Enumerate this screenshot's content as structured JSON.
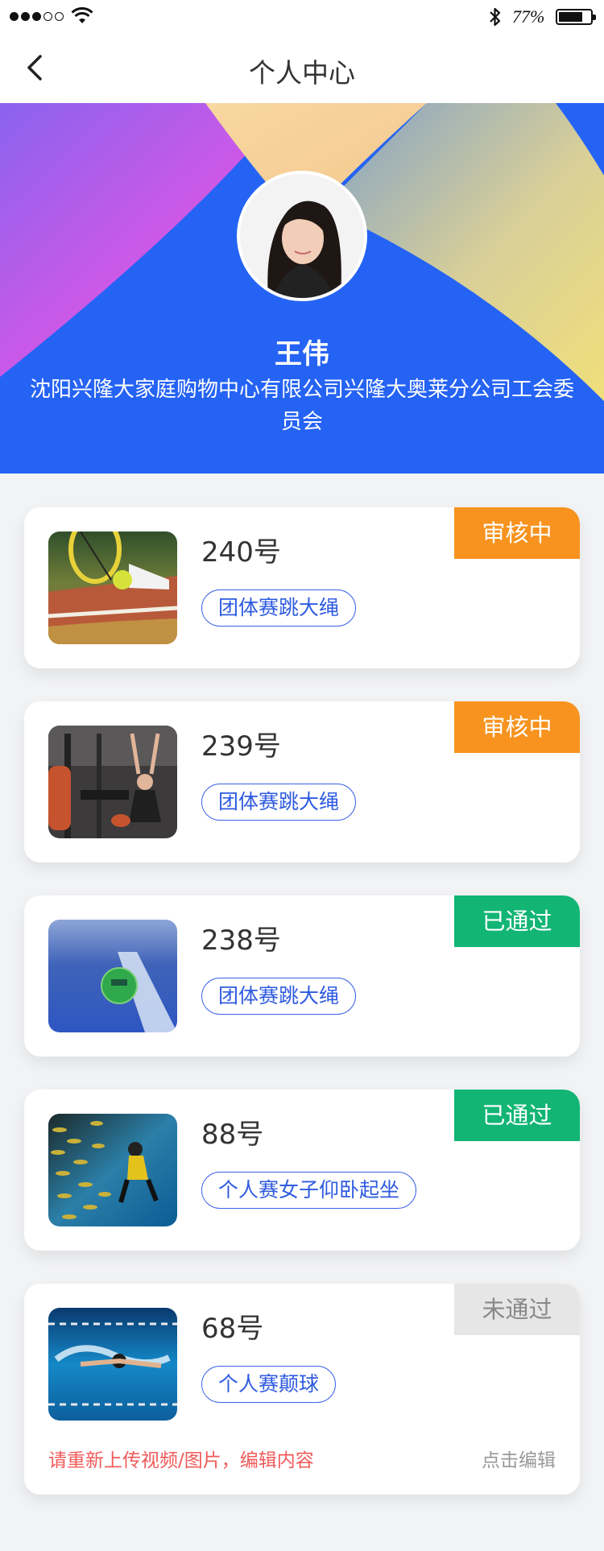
{
  "status_bar": {
    "battery_text": "77%",
    "battery_level": 0.77,
    "signal_filled": 3,
    "signal_total": 5
  },
  "nav": {
    "title": "个人中心",
    "back_icon": "chevron-left-icon"
  },
  "profile": {
    "name": "王伟",
    "organization": "沈阳兴隆大家庭购物中心有限公司兴隆大奥莱分公司工会委员会"
  },
  "colors": {
    "blue": "#2563f4",
    "pending": "#f7931e",
    "passed": "#12b574",
    "failed": "#e6e6e6",
    "tag": "#2f5be0",
    "warning_text": "#f05a5a"
  },
  "entries": [
    {
      "number": "240号",
      "tag": "团体赛跳大绳",
      "status": "审核中",
      "status_type": "pending",
      "image": "tennis-shoes-photo"
    },
    {
      "number": "239号",
      "tag": "团体赛跳大绳",
      "status": "审核中",
      "status_type": "pending",
      "image": "gym-woman-photo"
    },
    {
      "number": "238号",
      "tag": "团体赛跳大绳",
      "status": "已通过",
      "status_type": "passed",
      "image": "tennis-ball-court-photo"
    },
    {
      "number": "88号",
      "tag": "个人赛女子仰卧起坐",
      "status": "已通过",
      "status_type": "passed",
      "image": "scuba-diver-photo"
    },
    {
      "number": "68号",
      "tag": "个人赛颠球",
      "status": "未通过",
      "status_type": "failed",
      "image": "swimmer-photo",
      "reject_note": "请重新上传视频/图片，编辑内容",
      "edit_label": "点击编辑"
    }
  ]
}
